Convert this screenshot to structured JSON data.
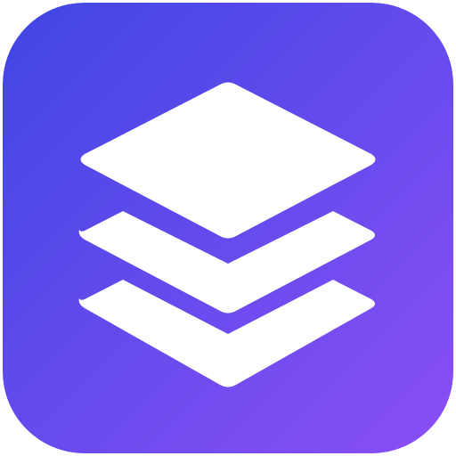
{
  "icon": {
    "name": "layers-app-icon",
    "symbol": "layers-icon",
    "colors": {
      "gradient_start": "#3F46E3",
      "gradient_end": "#8B4FF6",
      "glyph": "#FFFFFF",
      "background": "#FFFFFF"
    }
  }
}
